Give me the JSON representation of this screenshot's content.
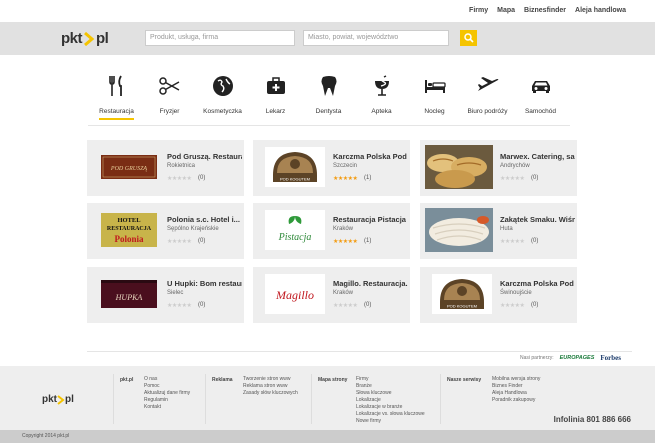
{
  "topnav": {
    "links": [
      "Firmy",
      "Mapa",
      "Biznesfinder",
      "Aleja handlowa"
    ]
  },
  "header": {
    "logo_left": "pkt",
    "logo_right": "pl",
    "search_what_placeholder": "Produkt, usługa, firma",
    "search_where_placeholder": "Miasto, powiat, województwo"
  },
  "categories": [
    {
      "label": "Restauracja",
      "icon": "fork-knife-icon"
    },
    {
      "label": "Fryzjer",
      "icon": "scissors-icon"
    },
    {
      "label": "Kosmetyczka",
      "icon": "globe-icon"
    },
    {
      "label": "Lekarz",
      "icon": "medical-kit-icon"
    },
    {
      "label": "Dentysta",
      "icon": "tooth-icon"
    },
    {
      "label": "Apteka",
      "icon": "pharmacy-icon"
    },
    {
      "label": "Nocleg",
      "icon": "bed-icon"
    },
    {
      "label": "Biuro podróży",
      "icon": "airplane-icon"
    },
    {
      "label": "Samochód",
      "icon": "car-icon"
    }
  ],
  "listings": [
    {
      "name": "Pod Gruszą. Restaura...",
      "city": "Rokietnica",
      "rating": 0,
      "count": "(0)",
      "thumb": "POD GRUSZĄ"
    },
    {
      "name": "Karczma Polska Pod K...",
      "city": "Szczecin",
      "rating": 5,
      "count": "(1)",
      "thumb": "POD KOGUTEM"
    },
    {
      "name": "Marwex. Catering, sa...",
      "city": "Andrychów",
      "rating": 0,
      "count": "(0)",
      "thumb": ""
    },
    {
      "name": "Polonia s.c. Hotel i...",
      "city": "Sępólno Krajeńskie",
      "rating": 0,
      "count": "(0)",
      "thumb": "HOTEL RESTAURACJA Polonia"
    },
    {
      "name": "Restauracja Pistacja",
      "city": "Kraków",
      "rating": 5,
      "count": "(1)",
      "thumb": "Pistacja"
    },
    {
      "name": "Zakątek Smaku. Wiśni...",
      "city": "Huta",
      "rating": 0,
      "count": "(0)",
      "thumb": ""
    },
    {
      "name": "U Hupki: Bom restaur...",
      "city": "Sielec",
      "rating": 0,
      "count": "(0)",
      "thumb": "HUPKA"
    },
    {
      "name": "Magillo. Restauracja...",
      "city": "Kraków",
      "rating": 0,
      "count": "(0)",
      "thumb": "Magillo"
    },
    {
      "name": "Karczma Polska Pod K...",
      "city": "Świnoujście",
      "rating": 0,
      "count": "(0)",
      "thumb": "POD KOGUTEM"
    }
  ],
  "partners": {
    "label": "Nasi partnerzy:",
    "p1": "EUROPAGES",
    "p2": "Forbes"
  },
  "footer": {
    "logo_left": "pkt",
    "logo_right": "pl",
    "col1_title": "pkt.pl",
    "col1_links": [
      "O nas",
      "Pomoc",
      "Aktualizuj dane firmy",
      "Regulamin",
      "Kontakt"
    ],
    "col2_title": "Reklama",
    "col2_links": [
      "Tworzenie stron www",
      "Reklama stron www",
      "Zasady słów kluczowych"
    ],
    "col3_title": "Mapa strony",
    "col3_links": [
      "Firmy",
      "Branże",
      "Słowa kluczowe",
      "Lokalizacje",
      "Lokalizacje w branże",
      "Lokalizacje vs. słowa kluczowe",
      "Nowe firmy"
    ],
    "col4_title": "Nasze serwisy",
    "col4_links": [
      "Mobilna wersja strony",
      "Biznes Finder",
      "Aleja Handlowa",
      "Poradnik zakupowy"
    ],
    "infolinia": "Infolinia 801 886 666",
    "copyright": "Copyright 2014 pkt.pl"
  },
  "colors": {
    "accent": "#f5c400",
    "stars": "#f39c12"
  }
}
